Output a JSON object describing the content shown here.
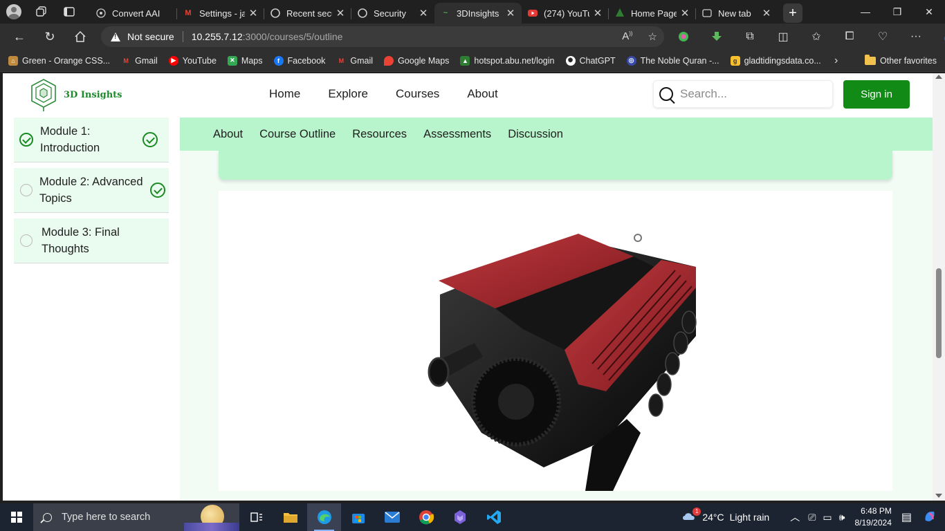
{
  "browser": {
    "tabs": [
      {
        "title": "Convert AAI",
        "favicon": "globe-icon"
      },
      {
        "title": "Settings - ja",
        "favicon": "gmail-icon"
      },
      {
        "title": "Recent secu",
        "favicon": "google-icon"
      },
      {
        "title": "Security",
        "favicon": "google-icon"
      },
      {
        "title": "3DInsights",
        "favicon": "3dinsights-icon",
        "active": true
      },
      {
        "title": "(274) YouTu",
        "favicon": "youtube-icon"
      },
      {
        "title": "Home Page",
        "favicon": "tree-icon"
      },
      {
        "title": "New tab",
        "favicon": "newtab-icon"
      }
    ],
    "address": {
      "security_label": "Not secure",
      "url_host": "10.255.7.12",
      "url_path": ":3000/courses/5/outline"
    },
    "favorites": [
      {
        "label": "Green - Orange CSS...",
        "icon": "lock-icon",
        "color": "#c08a3e"
      },
      {
        "label": "Gmail",
        "icon": "gmail-icon",
        "color": "#d93025"
      },
      {
        "label": "YouTube",
        "icon": "youtube-icon",
        "color": "#ff0000"
      },
      {
        "label": "Maps",
        "icon": "maps-icon",
        "color": "#34a853"
      },
      {
        "label": "Facebook",
        "icon": "facebook-icon",
        "color": "#1877f2"
      },
      {
        "label": "Gmail",
        "icon": "gmail-icon",
        "color": "#d93025"
      },
      {
        "label": "Google Maps",
        "icon": "maps-pin-icon",
        "color": "#ea4335"
      },
      {
        "label": "hotspot.abu.net/login",
        "icon": "tree-icon",
        "color": "#2e7d32"
      },
      {
        "label": "ChatGPT",
        "icon": "chatgpt-icon",
        "color": "#ffffff"
      },
      {
        "label": "The Noble Quran -...",
        "icon": "quran-icon",
        "color": "#3949ab"
      },
      {
        "label": "gladtidingsdata.co...",
        "icon": "gladtidings-icon",
        "color": "#fbc02d"
      }
    ],
    "other_favorites": "Other favorites"
  },
  "site": {
    "logo_text": "3D Insights",
    "nav": [
      "Home",
      "Explore",
      "Courses",
      "About"
    ],
    "search_placeholder": "Search...",
    "signin_label": "Sign in",
    "accent": "#118a16",
    "subnav": [
      "About",
      "Course Outline",
      "Resources",
      "Assessments",
      "Discussion"
    ],
    "modules": [
      {
        "line1": "Module 1:",
        "line2": "Introduction",
        "done": true
      },
      {
        "line1": "Module 2: Advanced",
        "line2": "Topics",
        "done": false
      },
      {
        "line1": "Module 3: Final",
        "line2": "Thoughts",
        "done": false
      }
    ]
  },
  "taskbar": {
    "search_placeholder": "Type here to search",
    "weather_temp": "24°C",
    "weather_desc": "Light rain",
    "weather_badge": "1",
    "time": "6:48 PM",
    "date": "8/19/2024"
  }
}
